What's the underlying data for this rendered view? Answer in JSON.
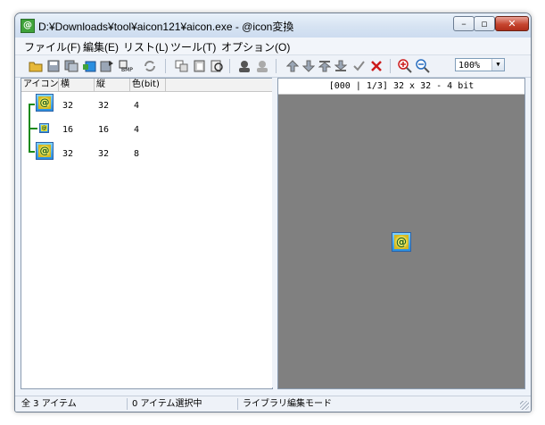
{
  "window": {
    "title": "D:¥Downloads¥tool¥aicon121¥aicon.exe - @icon変換",
    "title_icon_glyph": "@"
  },
  "menu": [
    "ファイル(F)",
    "編集(E)",
    "リスト(L)",
    "ツール(T)",
    "オプション(O)"
  ],
  "toolbar": {
    "buttons": [
      "open-folder-icon",
      "save-icon",
      "save-all-icon",
      "import-icon",
      "export-icon",
      "convert-icon",
      "refresh-icon",
      "copy-icon",
      "paste-icon",
      "zoom-page-icon",
      "user-icon",
      "user-gray-icon",
      "move-up-icon",
      "move-down-icon",
      "move-top-icon",
      "move-bottom-icon",
      "check-icon",
      "delete-icon",
      "zoom-in-icon",
      "zoom-out-icon"
    ],
    "zoom_value": "100%"
  },
  "list": {
    "columns": [
      "アイコン…",
      "横",
      "縦",
      "色(bit)"
    ],
    "rows": [
      {
        "width": "32",
        "height": "32",
        "bits": "4",
        "size": "large"
      },
      {
        "width": "16",
        "height": "16",
        "bits": "4",
        "size": "small"
      },
      {
        "width": "32",
        "height": "32",
        "bits": "8",
        "size": "large"
      }
    ]
  },
  "preview": {
    "header": "[000 | 1/3] 32 x 32 - 4 bit",
    "background": "#808080"
  },
  "status": {
    "count": "全 3 アイテム",
    "selected": "0 アイテム選択中",
    "mode": "ライブラリ編集モード"
  },
  "colors": {
    "accent": "#2a8ee0",
    "tree_line": "#1a8a1a",
    "delete": "#cc1a1a"
  }
}
